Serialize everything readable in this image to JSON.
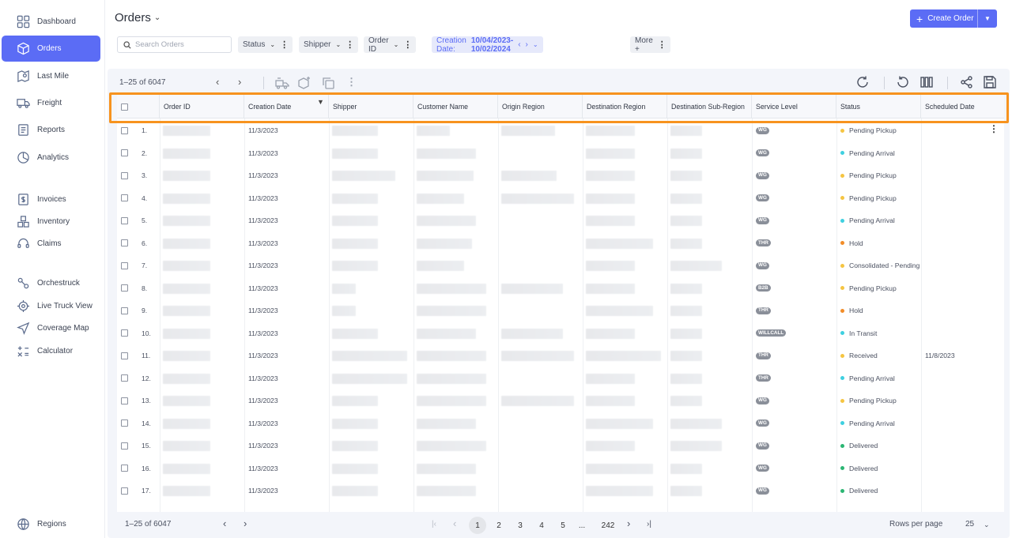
{
  "sidebar": {
    "items": [
      {
        "label": "Dashboard",
        "icon": "dashboard-icon"
      },
      {
        "label": "Orders",
        "icon": "box-icon",
        "active": true
      },
      {
        "label": "Last Mile",
        "icon": "map-pin-icon"
      },
      {
        "label": "Freight",
        "icon": "truck-icon"
      },
      {
        "label": "Reports",
        "icon": "report-icon"
      },
      {
        "label": "Analytics",
        "icon": "analytics-icon"
      },
      {
        "label": "Invoices",
        "icon": "invoice-icon"
      },
      {
        "label": "Inventory",
        "icon": "inventory-icon"
      },
      {
        "label": "Claims",
        "icon": "headset-icon"
      },
      {
        "label": "Orchestruck",
        "icon": "orchestruck-icon"
      },
      {
        "label": "Live Truck View",
        "icon": "target-icon"
      },
      {
        "label": "Coverage Map",
        "icon": "navigation-icon"
      },
      {
        "label": "Calculator",
        "icon": "calculator-icon"
      },
      {
        "label": "Regions",
        "icon": "globe-icon"
      }
    ]
  },
  "header": {
    "title": "Orders",
    "create_label": "Create Order"
  },
  "filters": {
    "search_placeholder": "Search Orders",
    "status": "Status",
    "shipper": "Shipper",
    "order_id": "Order ID",
    "date_label": "Creation Date:",
    "date_value": "10/04/2023-10/02/2024",
    "more": "More +"
  },
  "toolbar": {
    "count": "1–25 of 6047"
  },
  "columns": [
    "Order ID",
    "Creation Date",
    "Shipper",
    "Customer Name",
    "Origin Region",
    "Destination Region",
    "Destination Sub-Region",
    "Service Level",
    "Status",
    "Scheduled Date"
  ],
  "rows": [
    {
      "n": "1.",
      "date": "11/3/2023",
      "svc": "WG",
      "status": "Pending Pickup",
      "sched": ""
    },
    {
      "n": "2.",
      "date": "11/3/2023",
      "svc": "WG",
      "status": "Pending Arrival",
      "sched": ""
    },
    {
      "n": "3.",
      "date": "11/3/2023",
      "svc": "WG",
      "status": "Pending Pickup",
      "sched": ""
    },
    {
      "n": "4.",
      "date": "11/3/2023",
      "svc": "WG",
      "status": "Pending Pickup",
      "sched": ""
    },
    {
      "n": "5.",
      "date": "11/3/2023",
      "svc": "WG",
      "status": "Pending Arrival",
      "sched": ""
    },
    {
      "n": "6.",
      "date": "11/3/2023",
      "svc": "THR",
      "status": "Hold",
      "sched": ""
    },
    {
      "n": "7.",
      "date": "11/3/2023",
      "svc": "WG",
      "status": "Consolidated - Pending",
      "sched": ""
    },
    {
      "n": "8.",
      "date": "11/3/2023",
      "svc": "B2B",
      "status": "Pending Pickup",
      "sched": ""
    },
    {
      "n": "9.",
      "date": "11/3/2023",
      "svc": "THR",
      "status": "Hold",
      "sched": ""
    },
    {
      "n": "10.",
      "date": "11/3/2023",
      "svc": "WILLCALL",
      "status": "In Transit",
      "sched": ""
    },
    {
      "n": "11.",
      "date": "11/3/2023",
      "svc": "THR",
      "status": "Received",
      "sched": "11/8/2023"
    },
    {
      "n": "12.",
      "date": "11/3/2023",
      "svc": "THR",
      "status": "Pending Arrival",
      "sched": ""
    },
    {
      "n": "13.",
      "date": "11/3/2023",
      "svc": "WG",
      "status": "Pending Pickup",
      "sched": ""
    },
    {
      "n": "14.",
      "date": "11/3/2023",
      "svc": "WG",
      "status": "Pending Arrival",
      "sched": ""
    },
    {
      "n": "15.",
      "date": "11/3/2023",
      "svc": "WG",
      "status": "Delivered",
      "sched": ""
    },
    {
      "n": "16.",
      "date": "11/3/2023",
      "svc": "WG",
      "status": "Delivered",
      "sched": ""
    },
    {
      "n": "17.",
      "date": "11/3/2023",
      "svc": "WG",
      "status": "Delivered",
      "sched": ""
    }
  ],
  "status_colors": {
    "Pending Pickup": "#f5c542",
    "Pending Arrival": "#3fd0e0",
    "Hold": "#f28c28",
    "Consolidated - Pending": "#f5c542",
    "In Transit": "#3fd0e0",
    "Received": "#f5c542",
    "Delivered": "#2bb673"
  },
  "pager": {
    "count": "1–25 of 6047",
    "pages": [
      "1",
      "2",
      "3",
      "4",
      "5",
      "...",
      "242"
    ],
    "rows_per_page_label": "Rows per page",
    "rows_per_page": "25"
  },
  "colors": {
    "accent": "#5b6cf5",
    "highlight": "#f7931e"
  }
}
